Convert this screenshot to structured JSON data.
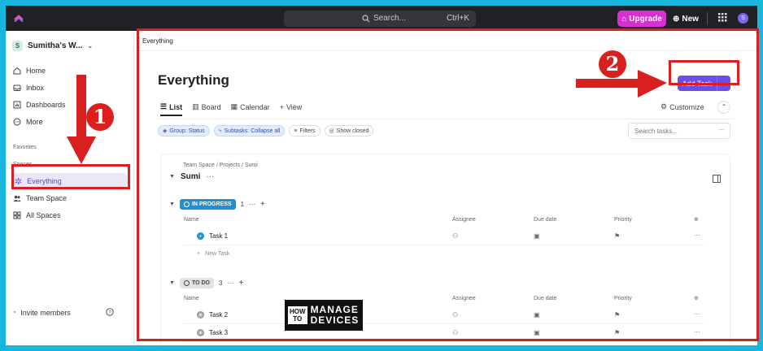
{
  "topbar": {
    "search_placeholder": "Search...",
    "search_shortcut": "Ctrl+K",
    "upgrade_label": "Upgrade",
    "new_label": "New",
    "avatar_initial": "S"
  },
  "sidebar": {
    "workspace_badge": "S",
    "workspace_name": "Sumitha's W...",
    "items": [
      {
        "label": "Home",
        "icon": "home-icon"
      },
      {
        "label": "Inbox",
        "icon": "inbox-icon"
      },
      {
        "label": "Dashboards",
        "icon": "dashboard-icon"
      },
      {
        "label": "More",
        "icon": "more-icon"
      }
    ],
    "favorites_heading": "Favorites",
    "spaces_heading": "Spaces",
    "spaces": [
      {
        "label": "Everything",
        "icon": "everything-icon",
        "active": true
      },
      {
        "label": "Team Space",
        "icon": "team-icon"
      },
      {
        "label": "All Spaces",
        "icon": "grid-icon"
      }
    ],
    "invite_label": "Invite members"
  },
  "main": {
    "breadcrumb": "Everything",
    "title": "Everything",
    "add_task_label": "Add Task",
    "tabs": [
      {
        "label": "List",
        "icon": "list-icon",
        "active": true
      },
      {
        "label": "Board",
        "icon": "board-icon"
      },
      {
        "label": "Calendar",
        "icon": "calendar-icon"
      },
      {
        "label": "View",
        "icon": "plus-icon"
      }
    ],
    "customize_label": "Customize",
    "filters": {
      "group_label": "Group: Status",
      "subtasks_label": "Subtasks: Collapse all",
      "filters_label": "Filters",
      "show_closed_label": "Show closed"
    },
    "search_tasks_placeholder": "Search tasks...",
    "list": {
      "breadcrumb": "Team Space / Projects / Sumi",
      "name": "Sumi",
      "columns": [
        "Name",
        "Assignee",
        "Due date",
        "Priority"
      ],
      "groups": [
        {
          "status": "IN PROGRESS",
          "count": "1",
          "tasks": [
            {
              "name": "Task 1"
            }
          ],
          "new_task_label": "New Task"
        },
        {
          "status": "TO DO",
          "count": "3",
          "tasks": [
            {
              "name": "Task 2"
            },
            {
              "name": "Task 3"
            }
          ]
        }
      ]
    }
  },
  "annotations": {
    "step1": "1",
    "step2": "2",
    "color": "#d9201f"
  },
  "watermark": {
    "how": "HOW",
    "to": "TO",
    "manage": "MANAGE",
    "devices": "DEVICES"
  }
}
